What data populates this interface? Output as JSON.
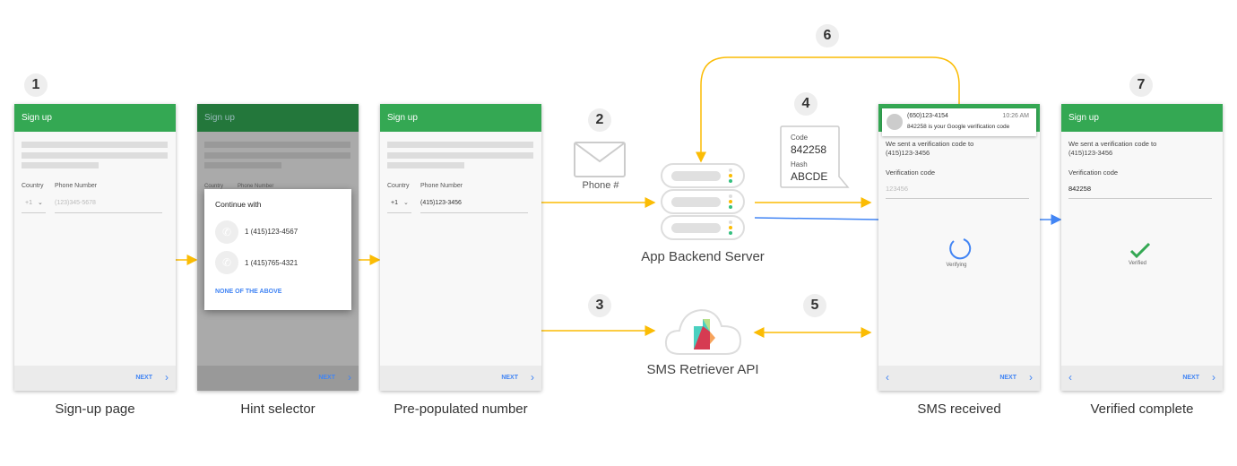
{
  "steps": [
    "1",
    "2",
    "3",
    "4",
    "5",
    "6",
    "7"
  ],
  "captions": [
    "Sign-up page",
    "Hint selector",
    "Pre-populated number",
    "SMS received",
    "Verified complete"
  ],
  "phone_header": "Sign up",
  "country_label": "Country",
  "phone_label": "Phone Number",
  "country_code": "+1",
  "phone_placeholder": "(123)345-5678",
  "phone_value": "(415)123-3456",
  "next_label": "NEXT",
  "hint": {
    "title": "Continue with",
    "options": [
      "1 (415)123-4567",
      "1 (415)765-4321"
    ],
    "none": "NONE OF THE ABOVE"
  },
  "envelope_label": "Phone #",
  "server_label": "App Backend Server",
  "api_label": "SMS Retriever API",
  "sms_bubble": {
    "code_label": "Code",
    "code": "842258",
    "hash_label": "Hash",
    "hash": "ABCDE"
  },
  "notification": {
    "sender": "(650)123-4154",
    "time": "10:26 AM",
    "message": "842258 is your Google verification code"
  },
  "verify": {
    "sent_text": "We sent a verification code to",
    "sent_number": "(415)123-3456",
    "code_label": "Verification code",
    "code_placeholder": "123456",
    "code_value": "842258",
    "verifying": "Verifying",
    "verified": "Verified"
  },
  "colors": {
    "green": "#34a853",
    "blue": "#4285f4",
    "yellow": "#fbbc04"
  }
}
